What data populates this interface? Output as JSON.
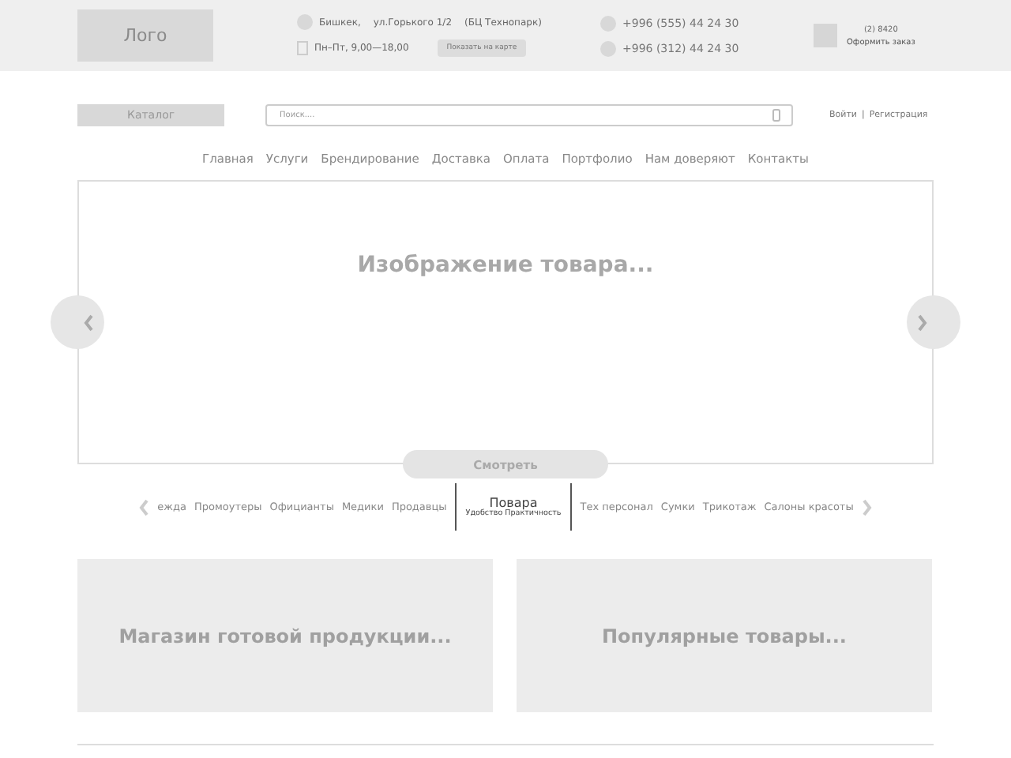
{
  "header": {
    "logo": "Лого",
    "address": {
      "city": "Бишкек,",
      "street": "ул.Горького 1/2",
      "place": "(БЦ Технопарк)"
    },
    "hours": "Пн–Пт, 9,00—18,00",
    "map_button": "Показать на карте",
    "phones": [
      "+996 (555) 44 24 30",
      "+996 (312) 44 24 30"
    ],
    "order": {
      "code": "(2) 8420",
      "label": "Оформить заказ"
    }
  },
  "catalog_button": "Каталог",
  "search": {
    "placeholder": "Поиск...."
  },
  "auth": {
    "login": "Войти",
    "separator": "|",
    "register": "Регистрация"
  },
  "nav": [
    "Главная",
    "Услуги",
    "Брендирование",
    "Доставка",
    "Оплата",
    "Портфолио",
    "Нам доверяют",
    "Контакты"
  ],
  "banner": {
    "caption": "Изображение товара...",
    "button": "Смотреть"
  },
  "categories": [
    {
      "label": "ежда",
      "selected": false
    },
    {
      "label": "Промоутеры",
      "selected": false
    },
    {
      "label": "Официанты",
      "selected": false
    },
    {
      "label": "Медики",
      "selected": false
    },
    {
      "label": "Продавцы",
      "selected": false
    },
    {
      "label": "Повара",
      "subtitle": "Удобство Практичность",
      "selected": true
    },
    {
      "label": "Тех персонал",
      "selected": false
    },
    {
      "label": "Сумки",
      "selected": false
    },
    {
      "label": "Трикотаж",
      "selected": false
    },
    {
      "label": "Салоны красоты",
      "selected": false
    }
  ],
  "cards": [
    "Магазин готовой продукции...",
    "Популярные товары..."
  ]
}
